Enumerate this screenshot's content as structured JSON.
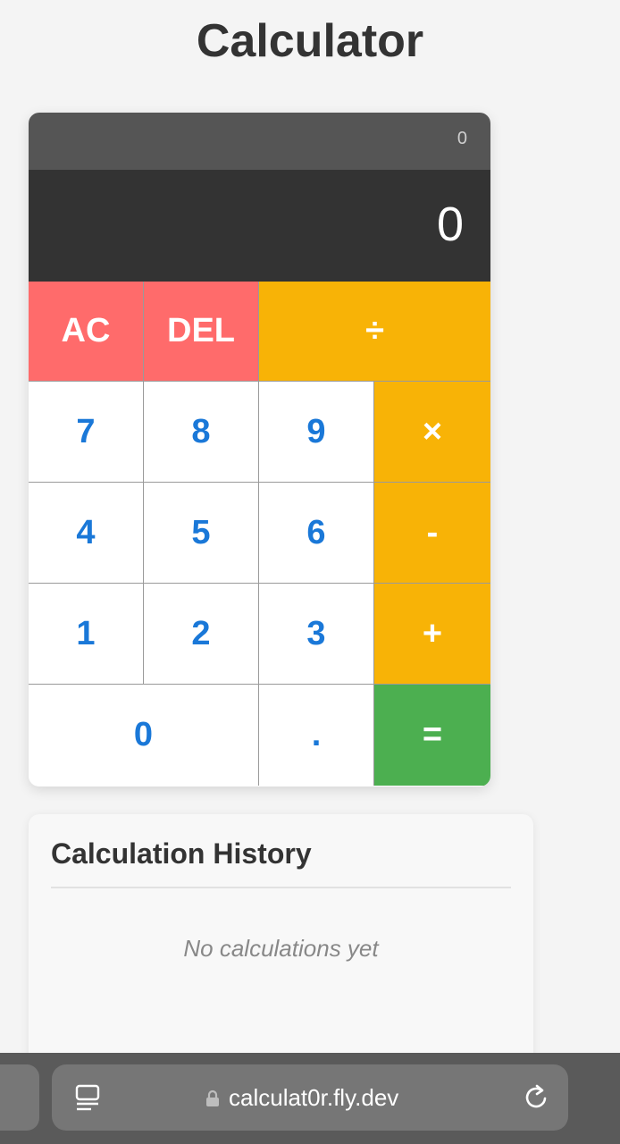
{
  "page": {
    "title": "Calculator"
  },
  "calculator": {
    "previous_value": "0",
    "current_value": "0",
    "keys": {
      "ac": "AC",
      "del": "DEL",
      "divide": "÷",
      "seven": "7",
      "eight": "8",
      "nine": "9",
      "multiply": "×",
      "four": "4",
      "five": "5",
      "six": "6",
      "minus": "-",
      "one": "1",
      "two": "2",
      "three": "3",
      "plus": "+",
      "zero": "0",
      "decimal": ".",
      "equals": "="
    }
  },
  "history": {
    "title": "Calculation History",
    "empty_message": "No calculations yet"
  },
  "browser": {
    "url": "calculat0r.fly.dev",
    "icons": {
      "reader": "reader-mode-icon",
      "lock": "lock-icon",
      "reload": "reload-icon"
    }
  },
  "colors": {
    "function_key": "#ff6b6b",
    "operator_key": "#f8b306",
    "equals_key": "#4caf50",
    "digit_text": "#1a78d8"
  }
}
